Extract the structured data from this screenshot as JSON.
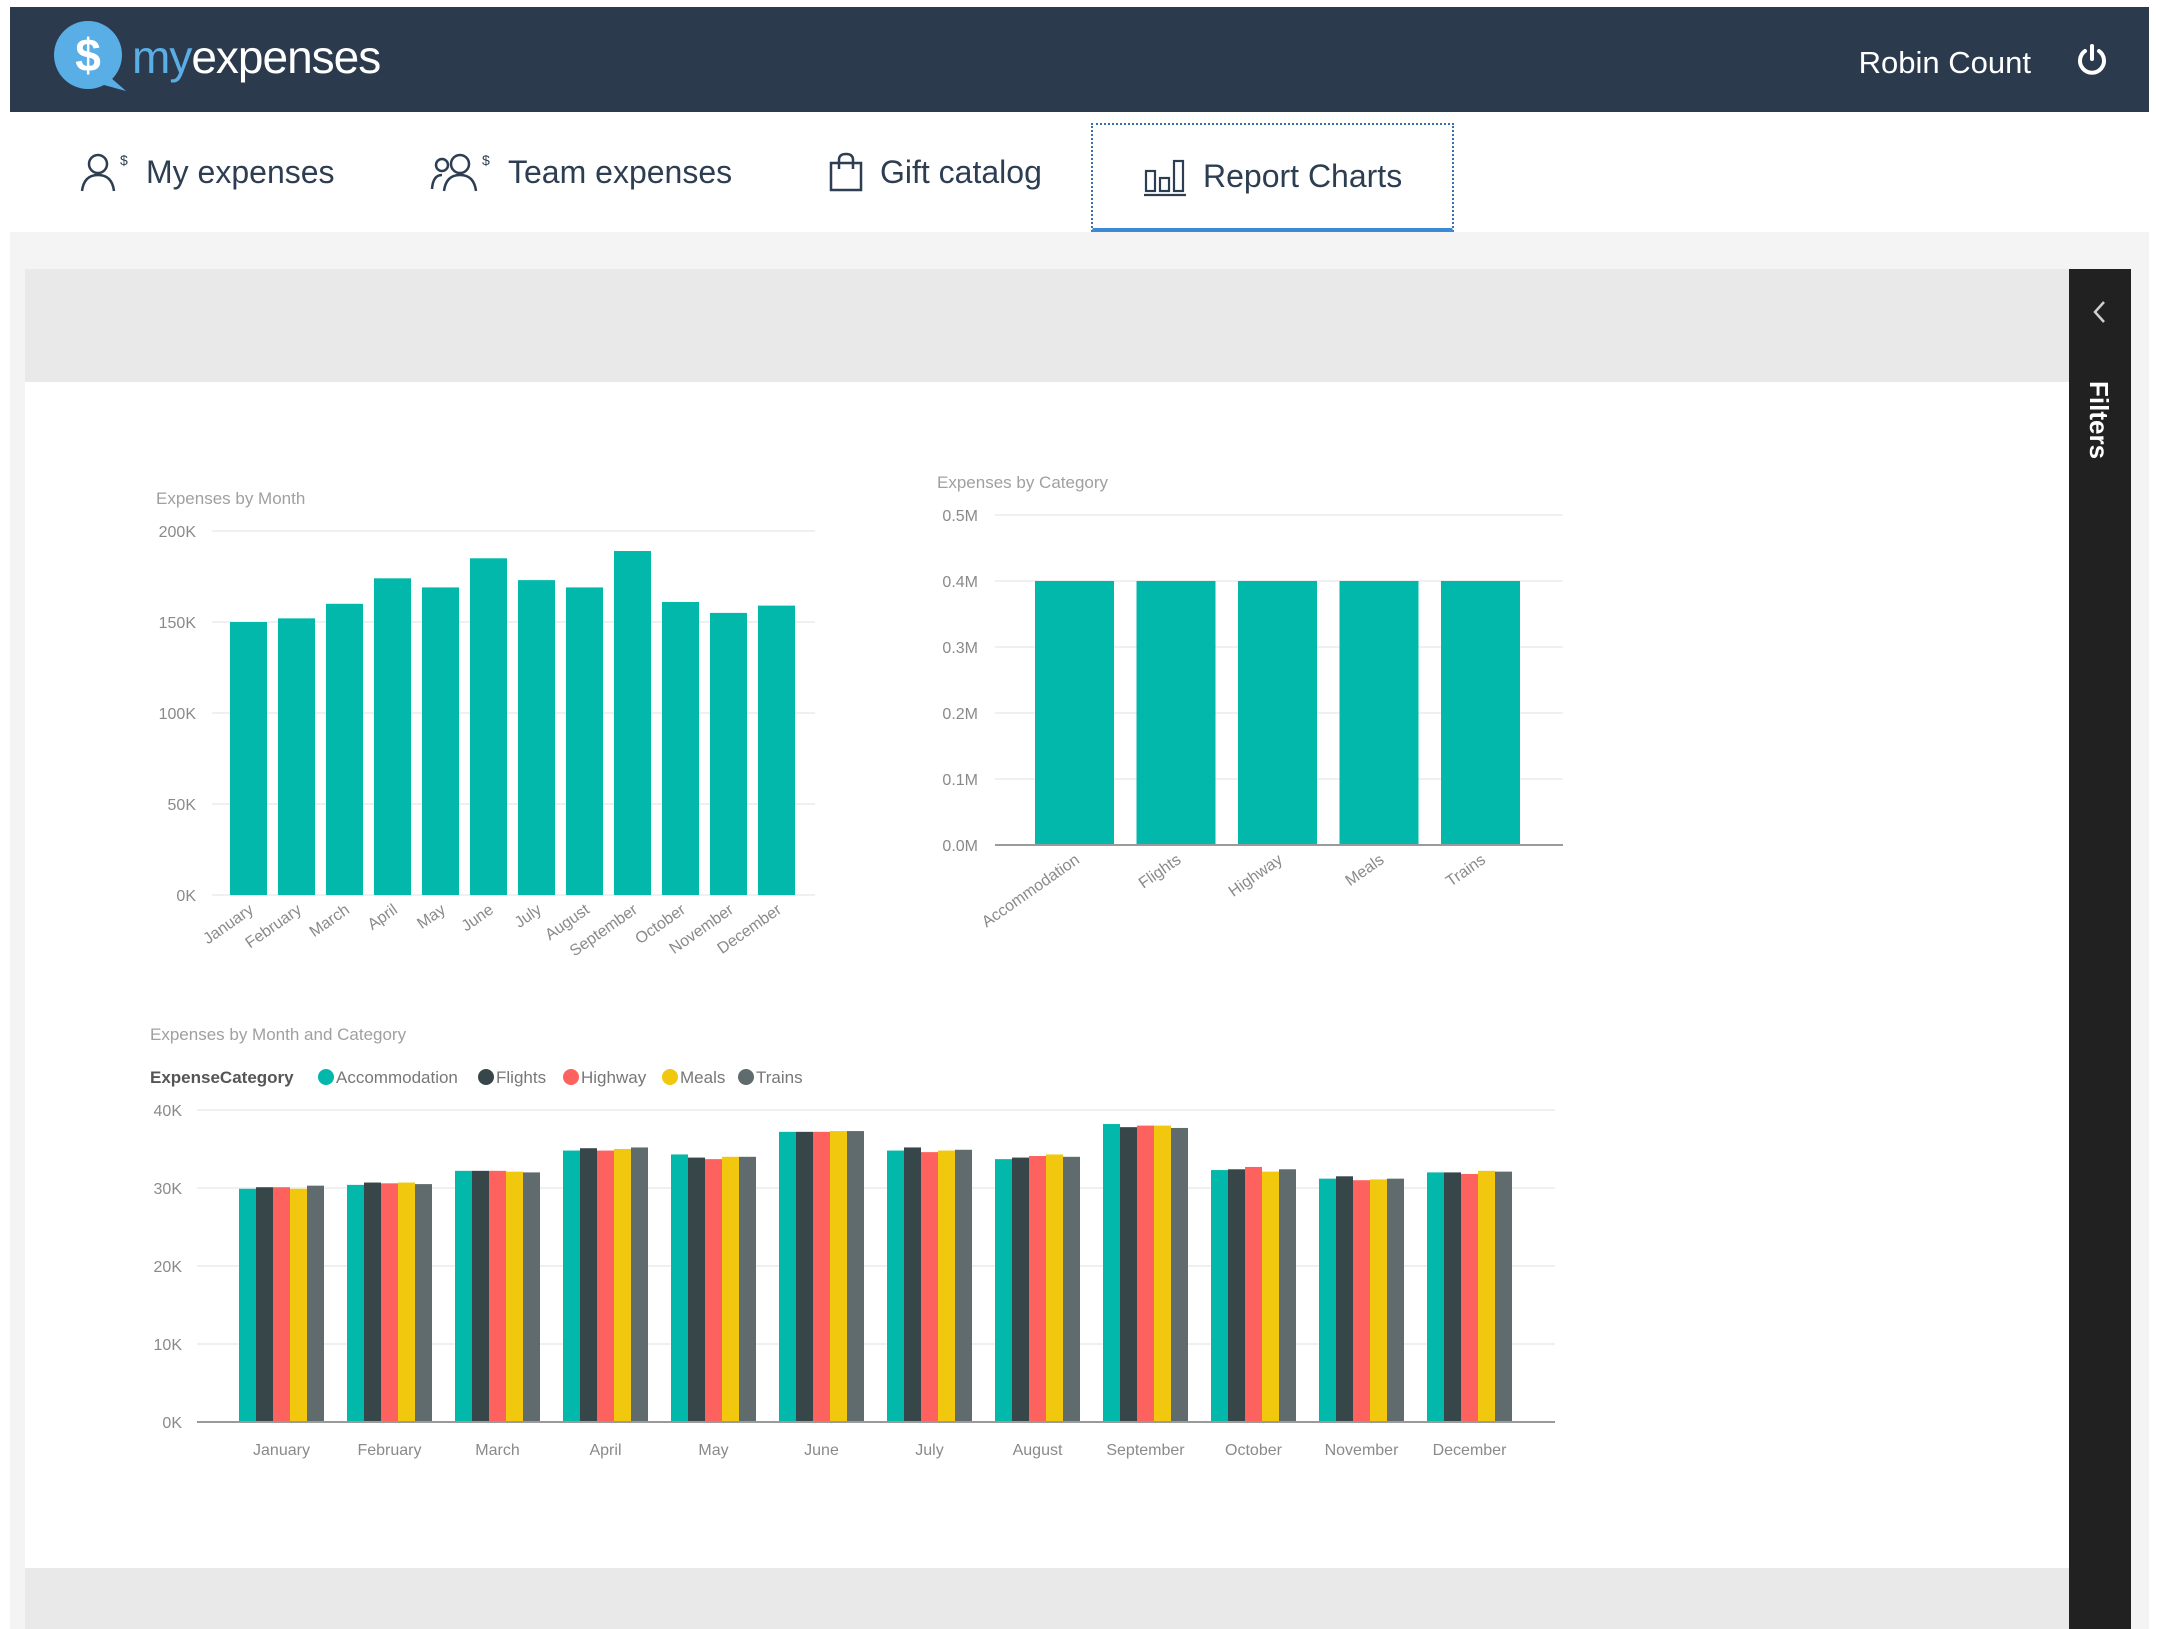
{
  "app": {
    "logo_my": "my",
    "logo_expenses": "expenses",
    "user_name": "Robin Count",
    "power_icon": "power-icon"
  },
  "nav": {
    "tabs": [
      {
        "label": "My expenses",
        "icon": "user-dollar-icon",
        "active": false
      },
      {
        "label": "Team expenses",
        "icon": "team-dollar-icon",
        "active": false
      },
      {
        "label": "Gift catalog",
        "icon": "shopping-bag-icon",
        "active": false
      },
      {
        "label": "Report Charts",
        "icon": "bar-chart-icon",
        "active": true
      }
    ]
  },
  "filters": {
    "label": "Filters",
    "icon": "chevron-left-icon"
  },
  "colors": {
    "teal": "#01b8aa",
    "flights": "#374649",
    "highway": "#fd625e",
    "meals": "#f2c80f",
    "trains": "#5f6b6d",
    "header": "#2c3a4e"
  },
  "chart_data": [
    {
      "type": "bar",
      "title": "Expenses by Month",
      "categories": [
        "January",
        "February",
        "March",
        "April",
        "May",
        "June",
        "July",
        "August",
        "September",
        "October",
        "November",
        "December"
      ],
      "values": [
        150000,
        152000,
        160000,
        174000,
        169000,
        185000,
        173000,
        169000,
        189000,
        161000,
        155000,
        159000
      ],
      "ylim": [
        0,
        200000
      ],
      "yticks": [
        "0K",
        "50K",
        "100K",
        "150K",
        "200K"
      ],
      "ytick_values": [
        0,
        50000,
        100000,
        150000,
        200000
      ],
      "xlabel": "",
      "ylabel": "",
      "grid": true
    },
    {
      "type": "bar",
      "title": "Expenses by Category",
      "categories": [
        "Accommodation",
        "Flights",
        "Highway",
        "Meals",
        "Trains"
      ],
      "values": [
        400000,
        400000,
        400000,
        400000,
        400000
      ],
      "ylim": [
        0,
        500000
      ],
      "yticks": [
        "0.0M",
        "0.1M",
        "0.2M",
        "0.3M",
        "0.4M",
        "0.5M"
      ],
      "ytick_values": [
        0,
        100000,
        200000,
        300000,
        400000,
        500000
      ],
      "xlabel": "",
      "ylabel": "",
      "grid": true
    },
    {
      "type": "bar",
      "title": "Expenses by Month and Category",
      "legend_title": "ExpenseCategory",
      "legend_position": "top-left",
      "categories": [
        "January",
        "February",
        "March",
        "April",
        "May",
        "June",
        "July",
        "August",
        "September",
        "October",
        "November",
        "December"
      ],
      "series": [
        {
          "name": "Accommodation",
          "color": "#01b8aa",
          "values": [
            29900,
            30400,
            32200,
            34800,
            34300,
            37200,
            34800,
            33700,
            38200,
            32300,
            31200,
            32000
          ]
        },
        {
          "name": "Flights",
          "color": "#374649",
          "values": [
            30100,
            30700,
            32200,
            35100,
            33900,
            37200,
            35200,
            33900,
            37800,
            32400,
            31500,
            32000
          ]
        },
        {
          "name": "Highway",
          "color": "#fd625e",
          "values": [
            30100,
            30600,
            32200,
            34800,
            33700,
            37200,
            34600,
            34100,
            38000,
            32700,
            31000,
            31800
          ]
        },
        {
          "name": "Meals",
          "color": "#f2c80f",
          "values": [
            29900,
            30700,
            32100,
            35000,
            34000,
            37300,
            34800,
            34300,
            38000,
            32100,
            31100,
            32200
          ]
        },
        {
          "name": "Trains",
          "color": "#5f6b6d",
          "values": [
            30300,
            30500,
            32000,
            35200,
            34000,
            37300,
            34900,
            34000,
            37700,
            32400,
            31200,
            32100
          ]
        }
      ],
      "ylim": [
        0,
        40000
      ],
      "yticks": [
        "0K",
        "10K",
        "20K",
        "30K",
        "40K"
      ],
      "ytick_values": [
        0,
        10000,
        20000,
        30000,
        40000
      ],
      "xlabel": "",
      "ylabel": "",
      "grid": true
    }
  ]
}
